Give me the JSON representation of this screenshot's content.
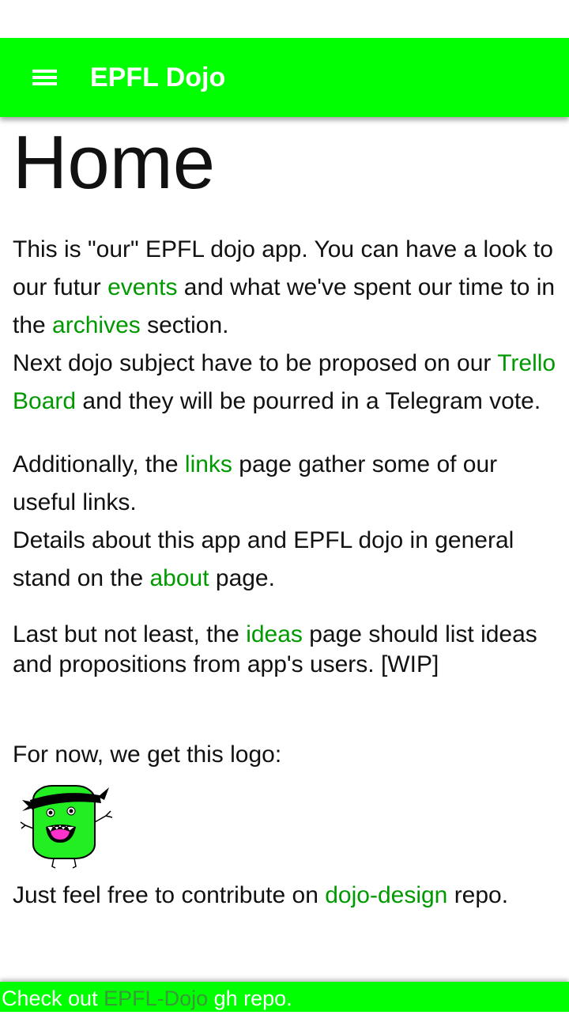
{
  "app": {
    "title": "EPFL Dojo",
    "menu_icon": "hamburger-menu-icon",
    "accent_color": "#00ff00",
    "link_color": "#009900"
  },
  "page": {
    "heading": "Home",
    "p1": {
      "t1": "This is \"our\" EPFL dojo app. You can have a look to our futur ",
      "link_events": "events",
      "t2": " and what we've spent our time to in the ",
      "link_archives": "archives",
      "t3": " section.",
      "t4": "Next dojo subject have to be proposed on our ",
      "link_trello": "Trello Board",
      "t5": " and they will be pourred in a Telegram vote."
    },
    "p2": {
      "t1": "Additionally, the ",
      "link_links": "links",
      "t2": " page gather some of our useful links.",
      "t3": "Details about this app and EPFL dojo in general stand on the ",
      "link_about": "about",
      "t4": " page."
    },
    "p3": {
      "t1": "Last but not least, the ",
      "link_ideas": "ideas",
      "t2": " page should list ideas and propositions from app's users. [WIP]"
    },
    "p4": {
      "t1": "For now, we get this logo:"
    },
    "logo_icon": "dojo-mascot-logo",
    "p5": {
      "t1": "Just feel free to contribute on ",
      "link_design": "dojo-design",
      "t2": " repo."
    }
  },
  "footer": {
    "t1": "Check out ",
    "link_repo": "EPFL-Dojo",
    "t2": " gh repo."
  }
}
